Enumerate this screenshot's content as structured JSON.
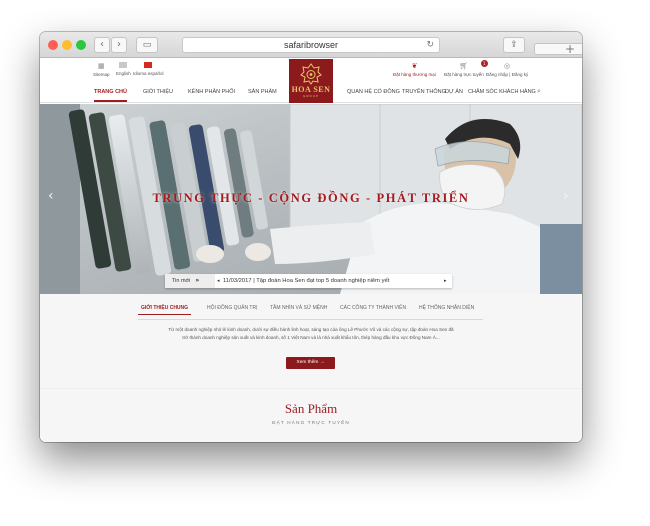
{
  "browser": {
    "url": "safaribrowser",
    "back_icon": "chevron-left-icon",
    "forward_icon": "chevron-right-icon",
    "reload_icon": "reload-icon"
  },
  "topbar": {
    "sitemap": "Sitemap",
    "english": "English",
    "spanish": "Idioma español",
    "order_distributor": "Đặt hàng thương mại",
    "order_online": "Đặt hàng trực tuyến",
    "cart_count": "1",
    "login": "Đăng nhập | Đăng ký"
  },
  "logo": {
    "name": "HOA SEN",
    "sub": "GROUP"
  },
  "nav": {
    "home": "TRANG CHỦ",
    "about": "GIỚI THIỆU",
    "distribution": "KÊNH PHÂN PHỐI",
    "products": "SẢN PHẨM",
    "investors": "QUAN HỆ CỔ ĐÔNG",
    "media": "TRUYỀN THÔNG",
    "projects": "DỰ ÁN",
    "care": "CHĂM SÓC KHÁCH HÀNG"
  },
  "hero": {
    "slogan": "TRUNG THỰC - CỘNG ĐỒNG - PHÁT TRIỂN",
    "ticker_label": "Tin mới",
    "ticker_text": "11/03/2017 | Tập đoàn Hoa Sen đạt top 5 doanh nghiệp niêm yết"
  },
  "intro": {
    "tabs": [
      "GIỚI THIỆU CHUNG",
      "HỘI ĐỒNG QUẢN TRỊ",
      "TẦM NHÌN VÀ SỨ MỆNH",
      "CÁC CÔNG TY THÀNH VIÊN",
      "HỆ THỐNG NHẬN DIỆN"
    ],
    "text": "Từ một doanh nghiệp nhỏ lẻ kinh doanh, dưới sự điều hành linh hoạt, sáng tạo của ông Lê Phước Vũ và các cộng sự, tập đoàn Hoa Sen đã trở thành doanh nghiệp sản xuất và kinh doanh, số 1 Việt Nam và là nhà xuất khẩu tôn, thép hàng đầu khu vực Đông Nam Á...",
    "button": "Xem thêm →"
  },
  "products": {
    "title": "Sản Phẩm",
    "subtitle": "ĐẶT HÀNG TRỰC TUYẾN"
  },
  "colors": {
    "brand": "#8c1a1d",
    "accent": "#a01d20",
    "gold": "#e8c56a"
  }
}
